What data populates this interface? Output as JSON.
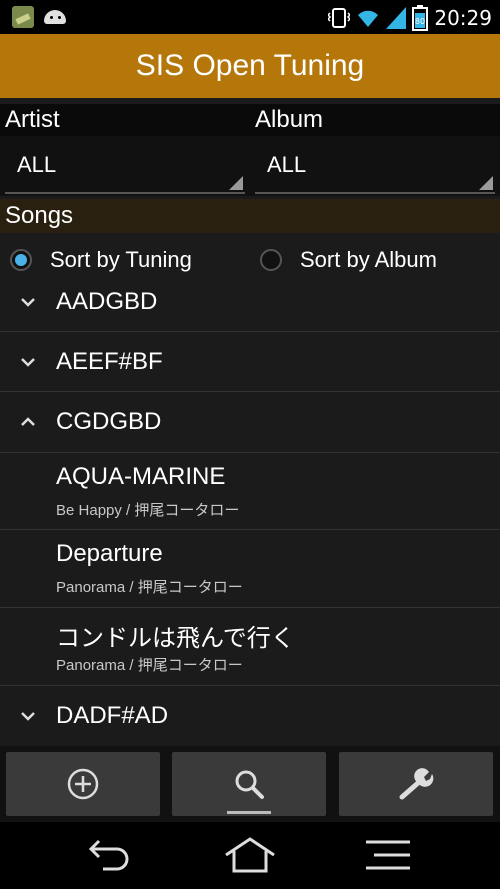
{
  "status": {
    "time": "20:29",
    "battery": "80"
  },
  "app": {
    "title": "SIS Open Tuning"
  },
  "filters": {
    "artist_label": "Artist",
    "album_label": "Album",
    "artist_value": "ALL",
    "album_value": "ALL"
  },
  "songs_label": "Songs",
  "sort": {
    "by_tuning": "Sort by Tuning",
    "by_album": "Sort by Album",
    "selected": "by_tuning"
  },
  "list": {
    "g1": "AADGBD",
    "g2": "AEEF#BF",
    "g3": "CGDGBD",
    "s1_title": "AQUA-MARINE",
    "s1_sub": "Be Happy / 押尾コータロー",
    "s2_title": "Departure",
    "s2_sub": "Panorama / 押尾コータロー",
    "s3_title": "コンドルは飛んで行く",
    "s3_sub": "Panorama / 押尾コータロー",
    "g4": "DADF#AD"
  },
  "icons": {
    "add": "add-circle-icon",
    "search": "search-icon",
    "settings": "wrench-icon",
    "back": "back-icon",
    "home": "home-icon",
    "menu": "menu-icon"
  },
  "colors": {
    "accent": "#b5760a",
    "radio_selected": "#4ab3e8"
  }
}
